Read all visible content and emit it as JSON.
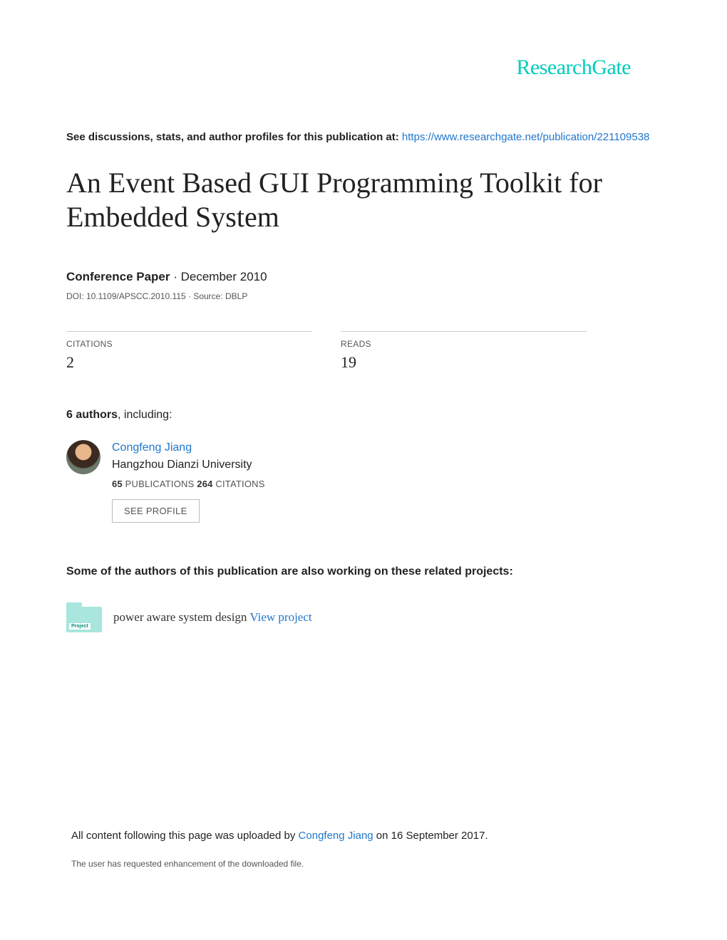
{
  "brand": "ResearchGate",
  "intro_text": "See discussions, stats, and author profiles for this publication at: ",
  "intro_link": "https://www.researchgate.net/publication/221109538",
  "title": "An Event Based GUI Programming Toolkit for Embedded System",
  "pub_type": "Conference Paper",
  "pub_date": "December 2010",
  "doi_line": "DOI: 10.1109/APSCC.2010.115 · Source: DBLP",
  "stats": {
    "citations_label": "CITATIONS",
    "citations_value": "2",
    "reads_label": "READS",
    "reads_value": "19"
  },
  "authors_count": "6 authors",
  "authors_suffix": ", including:",
  "author": {
    "name": "Congfeng Jiang",
    "affiliation": "Hangzhou Dianzi University",
    "pubs_num": "65",
    "pubs_label": " PUBLICATIONS   ",
    "cits_num": "264",
    "cits_label": " CITATIONS",
    "see_profile": "SEE PROFILE"
  },
  "related_heading": "Some of the authors of this publication are also working on these related projects:",
  "project": {
    "icon_label": "Project",
    "name": "power aware system design ",
    "view_link": "View project"
  },
  "footer": {
    "prefix": "All content following this page was uploaded by ",
    "uploader": "Congfeng Jiang",
    "suffix": " on 16 September 2017.",
    "note": "The user has requested enhancement of the downloaded file."
  }
}
